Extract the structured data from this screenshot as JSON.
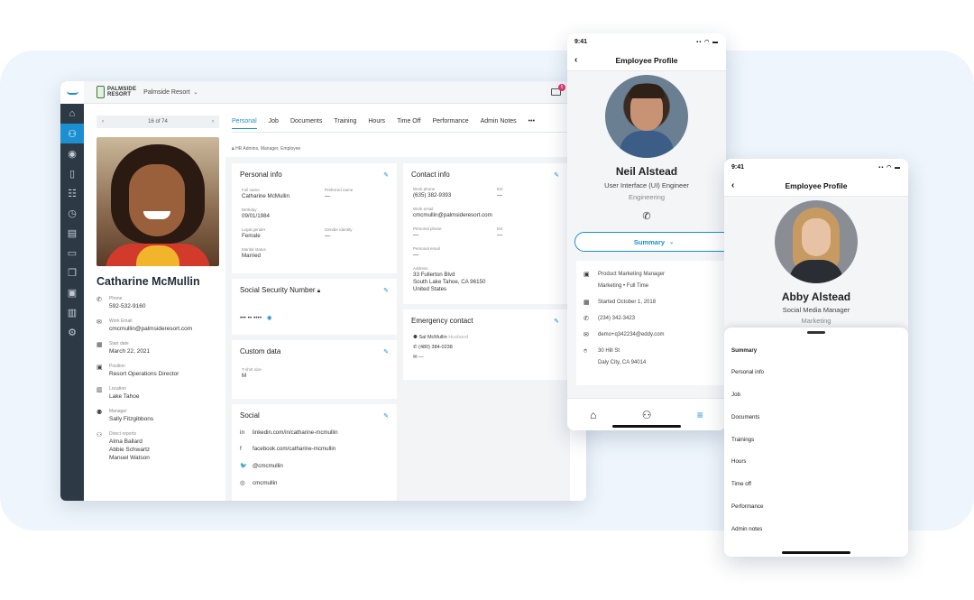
{
  "desktop": {
    "brand": {
      "line1": "PALMSIDE",
      "line2": "RESORT"
    },
    "org_selector": "Palmside Resort",
    "notification_count": "5",
    "pager": "16 of 74",
    "tabs": [
      "Personal",
      "Job",
      "Documents",
      "Training",
      "Hours",
      "Time Off",
      "Performance",
      "Admin Notes"
    ],
    "more_tabs": "•••",
    "access_note": "HR Admins, Manager, Employee",
    "employee": {
      "name": "Catharine McMullin",
      "details": [
        {
          "icon": "phone-icon",
          "glyph": "✆",
          "label": "Phone",
          "values": [
            "592-532-9160"
          ]
        },
        {
          "icon": "mail-icon",
          "glyph": "✉",
          "label": "Work Email",
          "values": [
            "cmcmullin@palmsideresort.com"
          ]
        },
        {
          "icon": "calendar-icon",
          "glyph": "▦",
          "label": "Start date",
          "values": [
            "March 22, 2021"
          ]
        },
        {
          "icon": "briefcase-icon",
          "glyph": "▣",
          "label": "Position",
          "values": [
            "Resort Operations Director"
          ]
        },
        {
          "icon": "building-icon",
          "glyph": "▥",
          "label": "Location",
          "values": [
            "Lake Tahoe"
          ]
        },
        {
          "icon": "manager-icon",
          "glyph": "⚉",
          "label": "Manager",
          "values": [
            "Sally Fitzgibbons"
          ]
        },
        {
          "icon": "team-icon",
          "glyph": "⚇",
          "label": "Direct reports",
          "values": [
            "Alma Ballard",
            "Abbie Schwartz",
            "Manuel Watson"
          ]
        }
      ]
    },
    "personal_info": {
      "title": "Personal info",
      "full_name_label": "Full name",
      "full_name": "Catharine McMullin",
      "preferred_label": "Preferred name",
      "preferred": "—",
      "birthday_label": "Birthday",
      "birthday": "09/01/1984",
      "legal_gender_label": "Legal gender",
      "legal_gender": "Female",
      "gender_identity_label": "Gender identity",
      "gender_identity": "—",
      "marital_label": "Marital status",
      "marital": "Married"
    },
    "ssn": {
      "title": "Social Security Number",
      "value": "••• •• ••••"
    },
    "custom_data": {
      "title": "Custom data",
      "tshirt_label": "T-shirt size",
      "tshirt": "M"
    },
    "social": {
      "title": "Social",
      "items": [
        {
          "icon": "linkedin-icon",
          "glyph": "in",
          "value": "linkedin.com/in/catharine-mcmullin"
        },
        {
          "icon": "facebook-icon",
          "glyph": "f",
          "value": "facebook.com/catharine-mcmullin"
        },
        {
          "icon": "twitter-icon",
          "glyph": "🐦",
          "value": "@cmcmullin"
        },
        {
          "icon": "instagram-icon",
          "glyph": "◎",
          "value": "cmcmullin"
        }
      ]
    },
    "contact_info": {
      "title": "Contact info",
      "work_phone_label": "Work phone",
      "work_phone": "(635) 382-9393",
      "ext_label": "Ext",
      "ext": "—",
      "work_email_label": "Work email",
      "work_email": "cmcmullin@palmsideresort.com",
      "personal_phone_label": "Personal phone",
      "personal_phone": "—",
      "ext2_label": "Ext",
      "ext2": "—",
      "personal_email_label": "Personal email",
      "personal_email": "—",
      "address_label": "Address",
      "address_line1": "33 Fullerton Blvd",
      "address_line2": "South Lake Tahoe, CA 96150",
      "address_line3": "United States"
    },
    "emergency": {
      "title": "Emergency contact",
      "name": "Sal McMullin",
      "relation": "Husband",
      "phone": "(480) 384-0238",
      "email": "—"
    }
  },
  "phone1": {
    "time": "9:41",
    "title": "Employee Profile",
    "name": "Neil Alstead",
    "job_title": "User Interface (UI) Engineer",
    "department": "Engineering",
    "summary_button": "Summary",
    "rows": [
      {
        "icon": "briefcase-icon",
        "glyph": "▣",
        "line1": "Product Marketing Manager",
        "line2": "Marketing • Full Time"
      },
      {
        "icon": "calendar-icon",
        "glyph": "▦",
        "line1": "Started October 1, 2018",
        "line2": ""
      },
      {
        "icon": "phone-icon",
        "glyph": "✆",
        "line1": "(234) 342-3423",
        "line2": ""
      },
      {
        "icon": "mail-icon",
        "glyph": "✉",
        "line1": "demo+q342234@eddy.com",
        "line2": ""
      },
      {
        "icon": "location-pin-icon",
        "glyph": "⌾",
        "line1": "30 Hill St",
        "line2": "Daly City, CA 94014"
      }
    ]
  },
  "phone2": {
    "time": "9:41",
    "title": "Employee Profile",
    "name": "Abby Alstead",
    "job_title": "Social Media Manager",
    "department": "Marketing",
    "menu": [
      "Summary",
      "Personal info",
      "Job",
      "Documents",
      "Trainings",
      "Hours",
      "Time off",
      "Performance",
      "Admin notes"
    ]
  },
  "colors": {
    "accent": "#1c8fd1",
    "rail": "#2d3a46",
    "background_panel": "#eef5fc"
  }
}
